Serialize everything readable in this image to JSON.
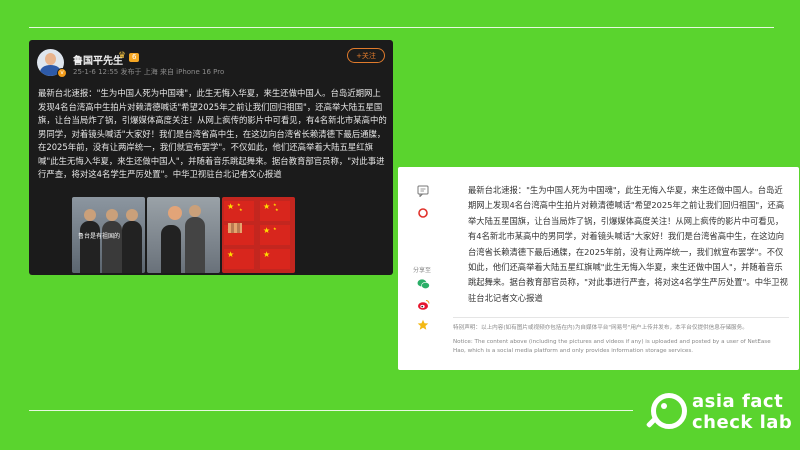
{
  "weibo_post": {
    "username": "鲁国平先生",
    "level_badge": "6",
    "meta": "25-1-6 12:55  发布于 上海  来自 iPhone 16 Pro",
    "follow_label": "+关注",
    "text": "最新台北速报：\"生为中国人死为中国魂\"，此生无悔入华夏，来生还做中国人。台岛近期网上发现4名台湾高中生拍片对赖清德喊话\"希望2025年之前让我们回归祖国\"，还高举大陆五星国旗，让台当局炸了锅，引爆媒体高度关注！从网上疯传的影片中可看见，有4名新北市某高中的男同学，对着镜头喊话\"大家好！我们是台湾省高中生，在这边向台湾省长赖清德下最后通牒，在2025年前，没有让两岸统一，我们就宣布罢学\"。不仅如此，他们还高举着大陆五星红旗喊\"此生无悔入华夏，来生还做中国人\"，并随着音乐跳起舞来。据台教育部官员称，\"对此事进行严查，将对这4名学生严厉处置\"。中华卫视驻台北记者文心报道",
    "image_caption": "鲁台是有祖国的"
  },
  "article": {
    "share_label": "分享至",
    "text": "最新台北速报：\"生为中国人死为中国魂\"，此生无悔入华夏，来生还做中国人。台岛近期网上发现4名台湾高中生拍片对赖清德喊话\"希望2025年之前让我们回归祖国\"，还高举大陆五星国旗，让台当局炸了锅，引爆媒体高度关注！从网上疯传的影片中可看见，有4名新北市某高中的男同学，对着镜头喊话\"大家好！我们是台湾省高中生，在这边向台湾省长赖清德下最后通牒，在2025年前，没有让两岸统一，我们就宣布罢学\"。不仅如此，他们还高举着大陆五星红旗喊\"此生无悔入华夏，来生还做中国人\"，并随着音乐跳起舞来。据台教育部官员称，\"对此事进行严查，将对这4名学生严厉处置\"。中华卫视驻台北记者文心报道",
    "disclaimer_zh": "特别声明：以上内容(如有图片或视频亦包括在内)为自媒体平台\"网易号\"用户上传并发布，本平台仅提供信息存储服务。",
    "disclaimer_en": "Notice: The content above (including the pictures and videos if any) is uploaded and posted by a user of NetEase Hao, which is a social media platform and only provides information storage services."
  },
  "logo": {
    "line1": "asia fact",
    "line2": "check lab"
  },
  "colors": {
    "background": "#5ad42e",
    "dark_card": "#1b1b1b",
    "follow_orange": "#e07b2c"
  },
  "icons": [
    "comment-icon",
    "netease-logo-icon",
    "wechat-icon",
    "weibo-icon",
    "star-icon",
    "verified-icon"
  ]
}
